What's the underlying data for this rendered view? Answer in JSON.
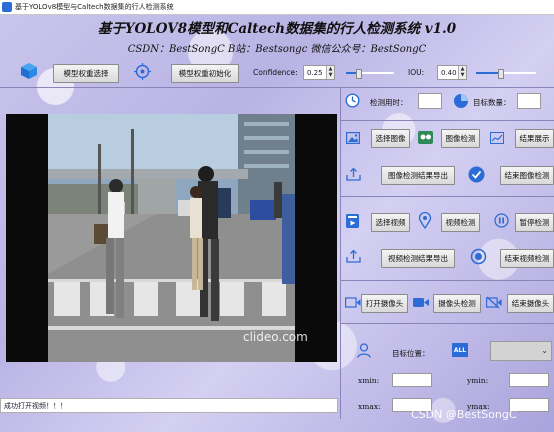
{
  "window": {
    "title": "基于YOLOv8模型与Caltech数据集的行人检测系统"
  },
  "header": {
    "title": "基于YOLOV8模型和Caltech数据集的行人检测系统 v1.0",
    "subtitle": "CSDN：BestSongC   B站：Bestsongc   微信公众号：BestSongC"
  },
  "toolbar": {
    "model_select_label": "模型权重选择",
    "model_init_label": "模型权重初始化",
    "confidence_label": "Confidence:",
    "confidence_value": "0.25",
    "iou_label": "IOU:",
    "iou_value": "0.40",
    "confidence_level": 0.25,
    "iou_level": 0.4
  },
  "stats": {
    "time_label": "检测用时：",
    "time_value": "",
    "count_label": "目标数量：",
    "count_value": ""
  },
  "image_section": {
    "select_label": "选择图像",
    "detect_label": "图像检测",
    "show_label": "结果展示",
    "export_label": "图像检测结果导出",
    "end_label": "结束图像检测"
  },
  "video_section": {
    "select_label": "选择视频",
    "detect_label": "视频检测",
    "pause_label": "暂停检测",
    "export_label": "视频检测结果导出",
    "end_label": "结束视频检测"
  },
  "camera_section": {
    "open_label": "打开摄像头",
    "detect_label": "摄像头检测",
    "end_label": "结束摄像头"
  },
  "position": {
    "label": "目标位置：",
    "all_badge": "ALL",
    "select_value": "",
    "xmin_label": "xmin:",
    "ymin_label": "ymin:",
    "xmax_label": "xmax:",
    "ymax_label": "ymax:",
    "xmin": "",
    "ymin": "",
    "xmax": "",
    "ymax": ""
  },
  "video_watermark": "clideo.com",
  "page_watermark": "CSDN @BestSongC",
  "status_text": "成功打开视频！！！",
  "colors": {
    "accent": "#2b6cd6",
    "panel_line": "#8a84b8"
  }
}
